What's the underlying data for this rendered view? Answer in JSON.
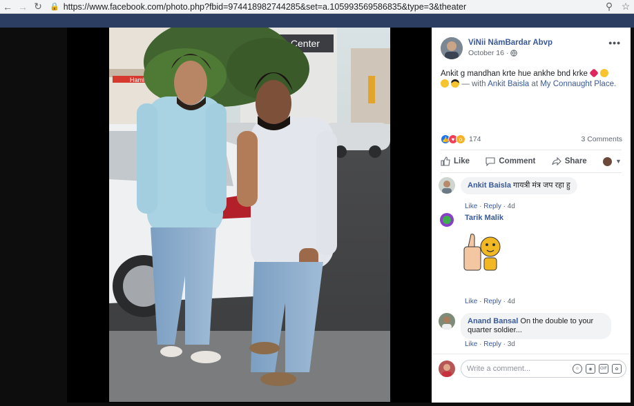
{
  "browser": {
    "url": "https://www.facebook.com/photo.php?fbid=974418982744285&set=a.105993569586835&type=3&theater"
  },
  "post": {
    "author": "ViNii NāmBardar Abvp",
    "date": "October 16",
    "text": "Ankit g mandhan krte hue ankhe bnd krke",
    "with_prefix": "— with",
    "tagged_person": "Ankit Baisla",
    "at_word": "at",
    "place": "My Connaught Place.",
    "reaction_count": "174",
    "comment_count": "3 Comments"
  },
  "actions": {
    "like": "Like",
    "comment": "Comment",
    "share": "Share"
  },
  "comments": [
    {
      "name": "Ankit Baisla",
      "text": "गायत्री मंत्र जप रहा हु",
      "like": "Like",
      "reply": "Reply",
      "age": "4d"
    },
    {
      "name": "Tarik Malik",
      "text": "",
      "like": "Like",
      "reply": "Reply",
      "age": "4d"
    },
    {
      "name": "Anand Bansal",
      "text": "On the double to your quarter soldier...",
      "like": "Like",
      "reply": "Reply",
      "age": "3d"
    }
  ],
  "write_comment": {
    "placeholder": "Write a comment..."
  },
  "photo_signs": {
    "store": "Hamleys",
    "building": "y Center"
  },
  "colors": {
    "fb_blue": "#385898",
    "like_blue": "#1877f2",
    "love_red": "#f33e58",
    "haha_yellow": "#f7b125"
  }
}
